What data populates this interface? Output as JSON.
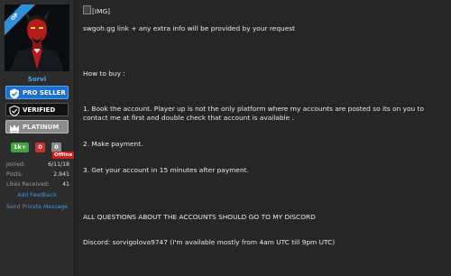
{
  "user": {
    "badge_op": "OP",
    "name": "Sorvi",
    "banners": {
      "pro": "PRO SELLER",
      "verified": "VERIFIED",
      "platinum": "PLATINUM"
    },
    "stats": {
      "positive": "1k+",
      "negative": "0",
      "neutral": "0"
    },
    "status": "Offline",
    "info": [
      {
        "label": "Joined:",
        "value": "6/11/18"
      },
      {
        "label": "Posts:",
        "value": "2,941"
      },
      {
        "label": "Likes Received:",
        "value": "41"
      }
    ],
    "links": {
      "add_feedback": "Add Feedback",
      "send_pm": "Send Private Message"
    }
  },
  "post": {
    "img_alt": "[IMG]",
    "line_swgoh": "swgoh.gg link + any extra info will be provided by your request",
    "how_to_buy": "How to buy :",
    "step1": "1. Book the account. Player up is not the only platform where my accounts are posted so its on you to contact me at first and double check that account is available .",
    "step2": "2. Make payment.",
    "step3": "3. Get your account in 15 minutes after payment.",
    "questions": "ALL QUESTIONS ABOUT THE ACCOUNTS SHOULD GO TO MY DISCORD",
    "discord": "Discord: sorvigolova9747 (I'm available mostly from 4am UTC till 9pm UTC)"
  },
  "colors": {
    "background": "#262626",
    "link_blue": "#47a7eb",
    "pro_blue": "#1a6fd0",
    "offline_red": "#c52121",
    "positive_green": "#3fa43f"
  },
  "icons": {
    "pro": "shield-check-icon",
    "verified": "shield-check-icon",
    "platinum": "crown-icon",
    "broken_image": "broken-image-icon"
  }
}
